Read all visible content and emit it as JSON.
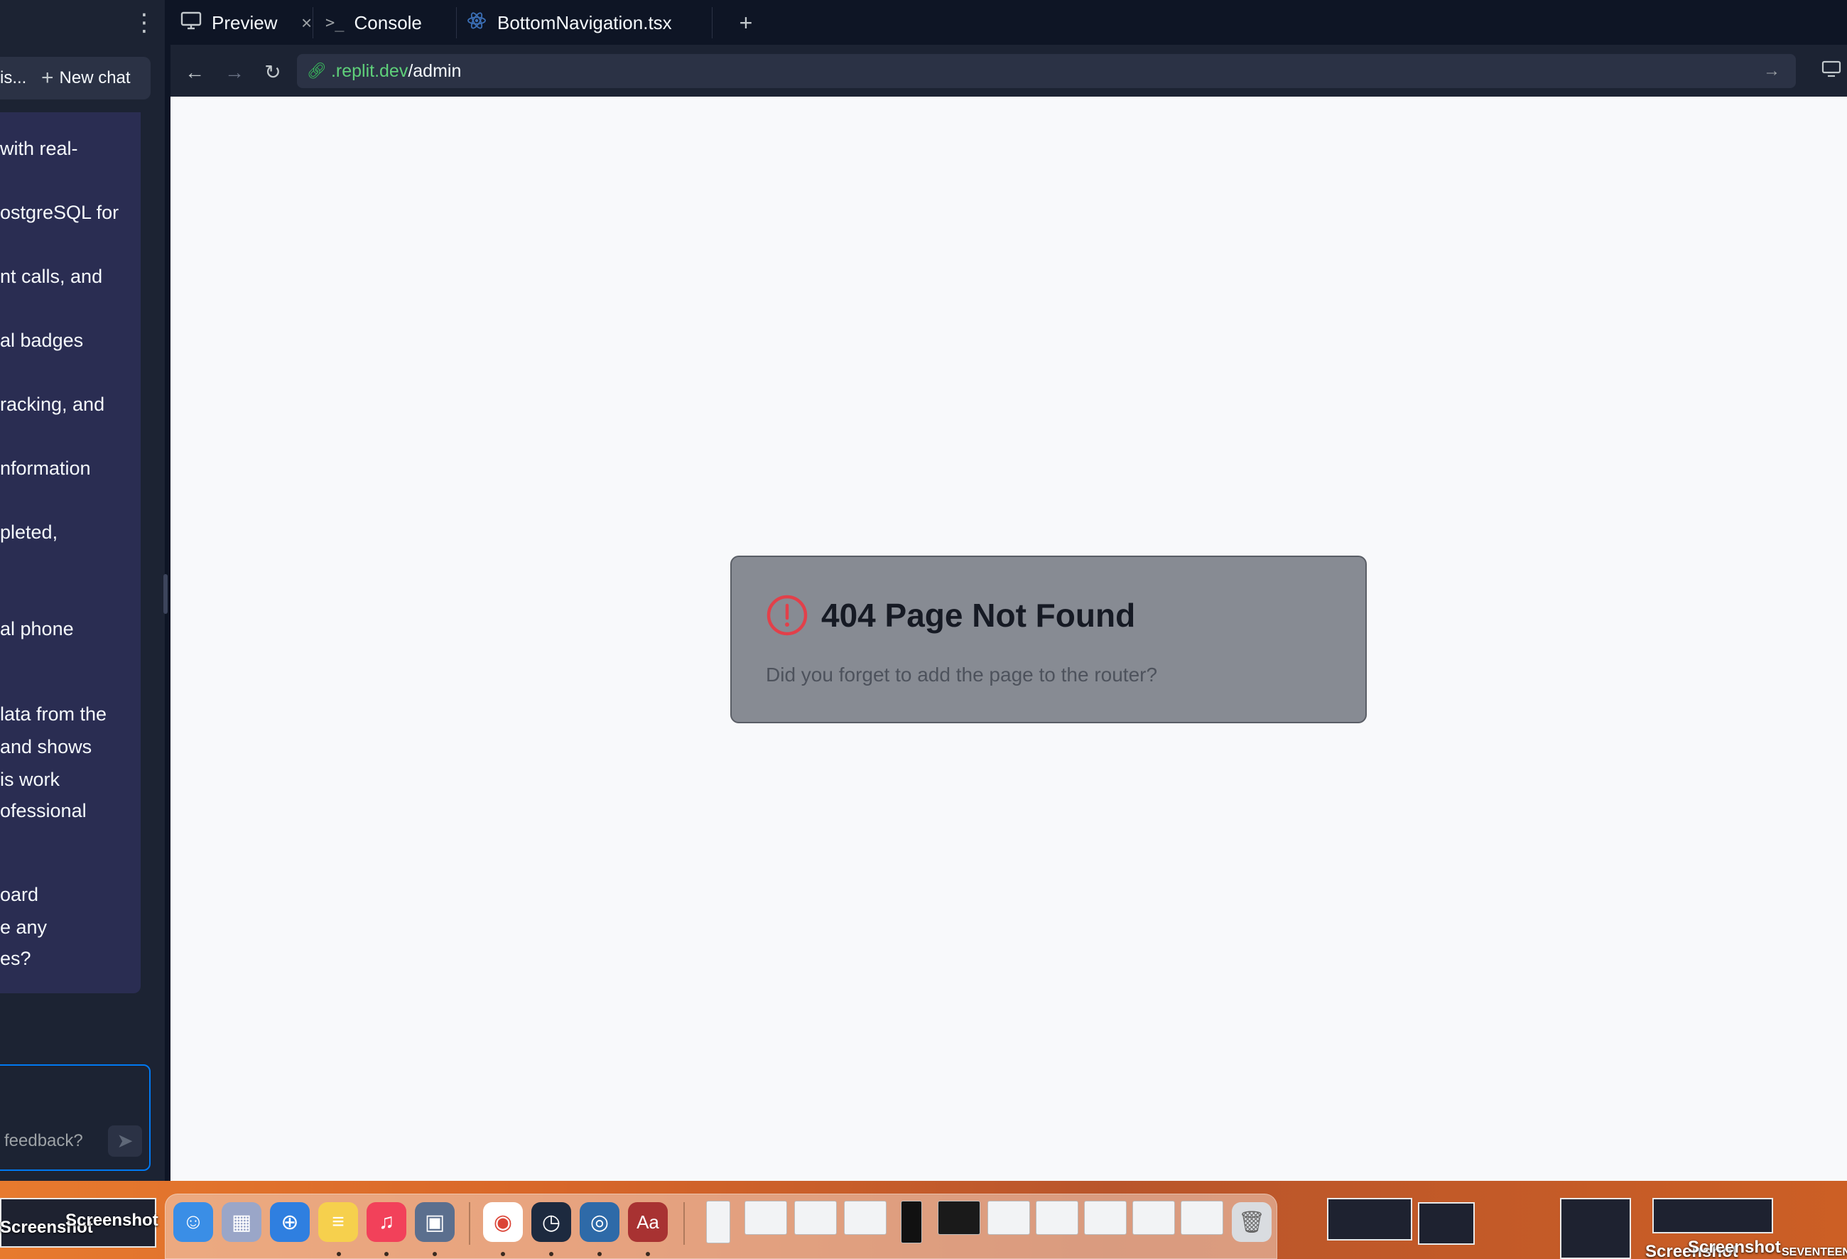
{
  "left_panel": {
    "header_truncated": "is...",
    "new_chat_label": "New chat",
    "messages": [
      " with real-",
      "ostgreSQL for",
      "nt calls, and",
      "al badges",
      "racking, and",
      "nformation",
      "pleted,",
      "al phone",
      "lata from the",
      "and shows",
      "is work",
      "ofessional",
      "oard",
      "e any",
      "es?"
    ],
    "input_placeholder": "feedback?"
  },
  "tabs": [
    {
      "label": "Preview",
      "icon": "monitor-icon",
      "active": true
    },
    {
      "label": "Console",
      "icon": "terminal-icon"
    },
    {
      "label": "BottomNavigation.tsx",
      "icon": "react-icon"
    }
  ],
  "url": {
    "domain": ".replit.dev",
    "path": "/admin"
  },
  "not_found": {
    "title": "404 Page Not Found",
    "subtitle": "Did you forget to add the page to the router?",
    "icon_color": "#e2404a"
  },
  "desktop": {
    "screenshot_labels": [
      "Screenshot",
      "Screenshot",
      "Screenshot",
      "Screenshot"
    ],
    "brand_label": "SEVENTEEN"
  },
  "colors": {
    "accent": "#0079f2",
    "url_domain": "#5fd07a",
    "error": "#e2404a"
  }
}
